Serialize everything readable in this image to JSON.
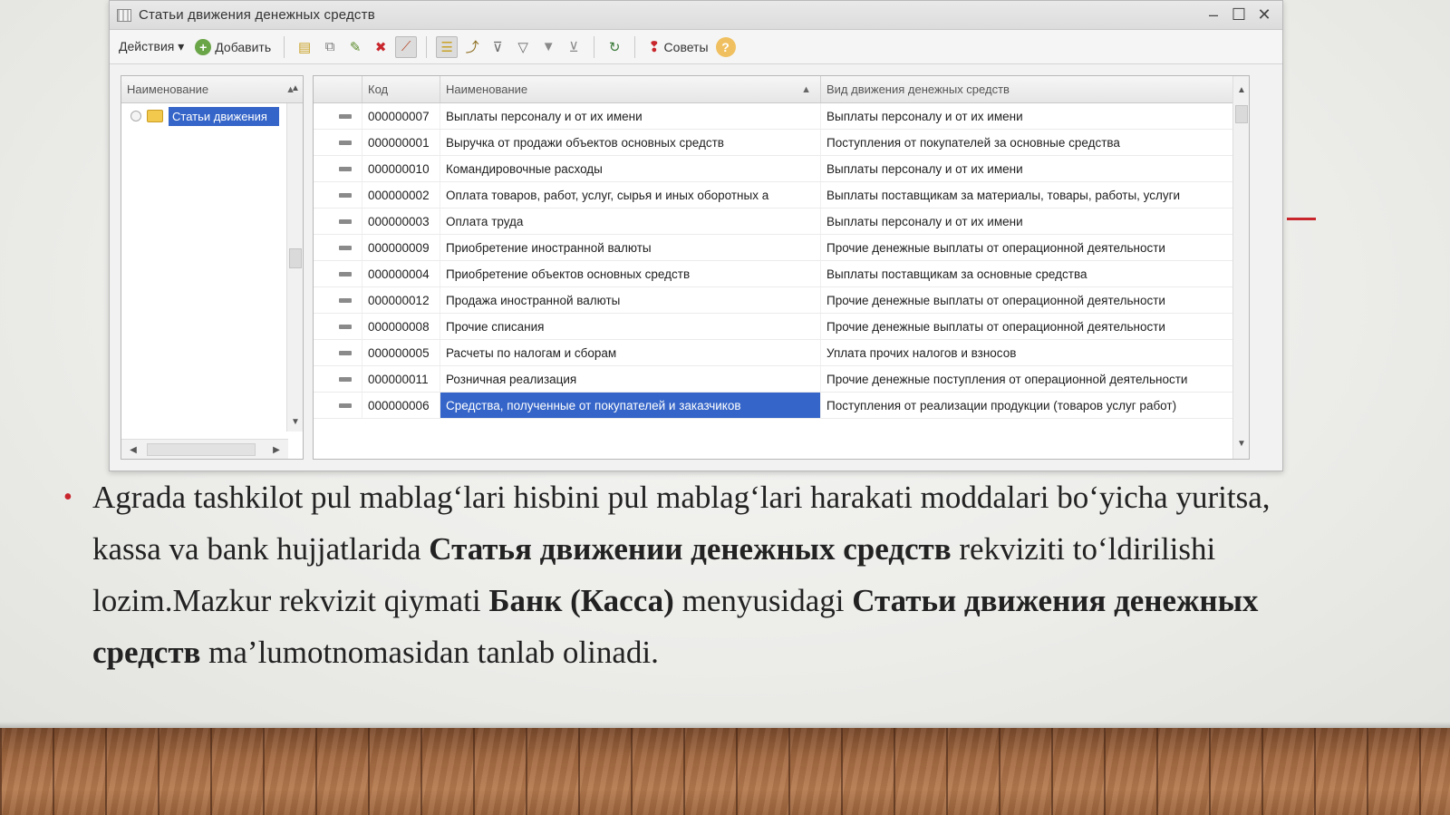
{
  "window": {
    "title": "Статьи движения денежных средств",
    "controls": {
      "minimize": "‒",
      "maximize": "☐",
      "close": "✕"
    }
  },
  "toolbar": {
    "actions_label": "Действия ▾",
    "add_label": "Добавить",
    "tips_label": "Советы"
  },
  "tree": {
    "header": "Наименование",
    "root_label": "Статьи движения"
  },
  "grid": {
    "headers": {
      "code": "Код",
      "name": "Наименование",
      "kind": "Вид движения денежных средств"
    },
    "rows": [
      {
        "code": "000000007",
        "name": "Выплаты персоналу и от их имени",
        "kind": "Выплаты персоналу и от их имени"
      },
      {
        "code": "000000001",
        "name": "Выручка от продажи объектов основных средств",
        "kind": "Поступления от покупателей за основные средства"
      },
      {
        "code": "000000010",
        "name": "Командировочные расходы",
        "kind": "Выплаты персоналу и от их имени"
      },
      {
        "code": "000000002",
        "name": "Оплата товаров, работ, услуг, сырья и иных оборотных а",
        "kind": "Выплаты поставщикам за материалы, товары, работы, услуги"
      },
      {
        "code": "000000003",
        "name": "Оплата труда",
        "kind": "Выплаты персоналу и от их имени"
      },
      {
        "code": "000000009",
        "name": "Приобретение иностранной валюты",
        "kind": "Прочие денежные выплаты от операционной деятельности"
      },
      {
        "code": "000000004",
        "name": "Приобретение объектов основных средств",
        "kind": "Выплаты поставщикам за основные средства"
      },
      {
        "code": "000000012",
        "name": "Продажа иностранной валюты",
        "kind": "Прочие денежные выплаты от операционной деятельности"
      },
      {
        "code": "000000008",
        "name": "Прочие списания",
        "kind": "Прочие денежные выплаты от операционной деятельности"
      },
      {
        "code": "000000005",
        "name": "Расчеты по налогам и сборам",
        "kind": "Уплата прочих налогов и взносов"
      },
      {
        "code": "000000011",
        "name": "Розничная реализация",
        "kind": "Прочие денежные поступления от операционной деятельности"
      },
      {
        "code": "000000006",
        "name": "Средства, полученные от покупателей и заказчиков",
        "kind": "Поступления от реализации продукции (товаров услуг работ)"
      }
    ]
  },
  "slide": {
    "bullet": {
      "t1": "Agrada tashkilot pul mablag‘lari hisbini pul mablag‘lari harakati moddalari bo‘yicha yuritsa, kassa va bank hujjatlarida ",
      "b1": "Статья движении денежных средств",
      "t2": " rekviziti to‘ldirilishi lozim.Mazkur rekvizit qiymati ",
      "b2": "Банк (Касса)",
      "t3": " menyusidagi ",
      "b3": "Статьи движения денежных средств",
      "t4": " ma’lumotnomasidan tanlab olinadi."
    }
  },
  "colors": {
    "accent": "#c8262c",
    "selection": "#3565c8"
  }
}
